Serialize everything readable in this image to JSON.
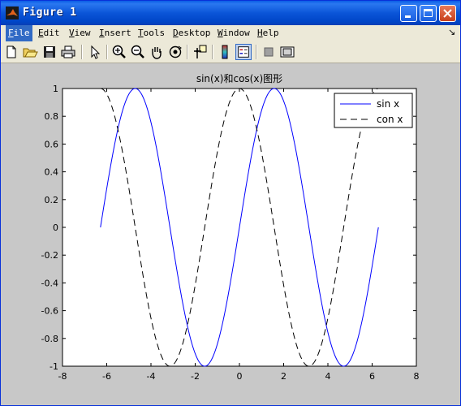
{
  "window": {
    "title": "Figure 1"
  },
  "menu": [
    {
      "label": "File",
      "accel": "F",
      "active": true
    },
    {
      "label": "Edit",
      "accel": "E"
    },
    {
      "label": "View",
      "accel": "V"
    },
    {
      "label": "Insert",
      "accel": "I"
    },
    {
      "label": "Tools",
      "accel": "T"
    },
    {
      "label": "Desktop",
      "accel": "D"
    },
    {
      "label": "Window",
      "accel": "W"
    },
    {
      "label": "Help",
      "accel": "H"
    }
  ],
  "toolbar": [
    "new-file-icon",
    "open-folder-icon",
    "save-icon",
    "print-icon",
    "pointer-icon",
    "zoom-in-icon",
    "zoom-out-icon",
    "pan-hand-icon",
    "rotate-3d-icon",
    "data-cursor-icon",
    "colorbar-icon",
    "legend-icon",
    "hide-plot-tools-icon",
    "show-plot-tools-icon"
  ],
  "chart_data": {
    "type": "line",
    "title": "sin(x)和cos(x)图形",
    "xlim": [
      -8,
      8
    ],
    "ylim": [
      -1,
      1
    ],
    "x_range": [
      -6.2832,
      6.2832
    ],
    "xticks": [
      -8,
      -6,
      -4,
      -2,
      0,
      2,
      4,
      6,
      8
    ],
    "yticks": [
      -1,
      -0.8,
      -0.6,
      -0.4,
      -0.2,
      0,
      0.2,
      0.4,
      0.6,
      0.8,
      1
    ],
    "legend_position": "top-right",
    "grid": false,
    "series": [
      {
        "name": "sin x",
        "function": "sin",
        "color": "#0000ff",
        "dash": "solid"
      },
      {
        "name": "con x",
        "function": "cos",
        "color": "#000000",
        "dash": "dashed"
      }
    ]
  }
}
